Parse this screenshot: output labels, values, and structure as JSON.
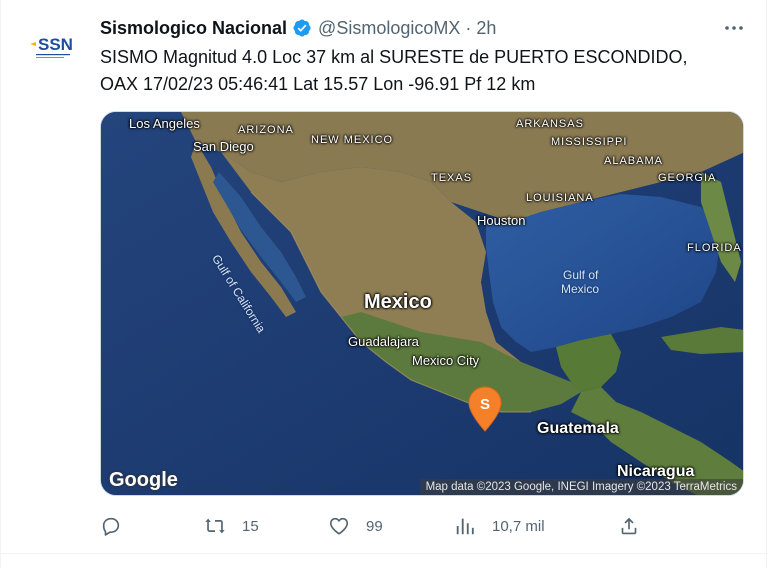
{
  "tweet": {
    "display_name": "Sismologico Nacional",
    "handle": "@SismologicoMX",
    "separator": "·",
    "time": "2h",
    "text": "SISMO Magnitud 4.0 Loc  37 km al SURESTE de PUERTO ESCONDIDO,\nOAX 17/02/23 05:46:41 Lat 15.57 Lon -96.91 Pf 12 km",
    "avatar_text": "SSN"
  },
  "map": {
    "labels": {
      "los_angeles": "Los Angeles",
      "san_diego": "San Diego",
      "arizona": "ARIZONA",
      "new_mexico": "NEW MEXICO",
      "texas": "TEXAS",
      "arkansas": "ARKANSAS",
      "mississippi": "MISSISSIPPI",
      "alabama": "ALABAMA",
      "georgia": "GEORGIA",
      "louisiana": "LOUISIANA",
      "houston": "Houston",
      "florida": "FLORIDA",
      "gulf_of_california": "Gulf of California",
      "gulf_of_mexico_line1": "Gulf of",
      "gulf_of_mexico_line2": "Mexico",
      "mexico": "Mexico",
      "guadalajara": "Guadalajara",
      "mexico_city": "Mexico City",
      "guatemala": "Guatemala",
      "nicaragua": "Nicaragua"
    },
    "pin_letter": "S",
    "google_logo": "Google",
    "attribution": "Map data ©2023 Google, INEGI Imagery ©2023 TerraMetrics",
    "colors": {
      "pin": "#f4812a",
      "water": "#1d3c74",
      "land": "#8a7a52"
    }
  },
  "actions": {
    "reply_count": "",
    "retweet_count": "15",
    "like_count": "99",
    "views_count": "10,7 mil"
  },
  "colors": {
    "verified": "#1d9bf0",
    "secondary_text": "#536471",
    "text": "#0f1419"
  }
}
